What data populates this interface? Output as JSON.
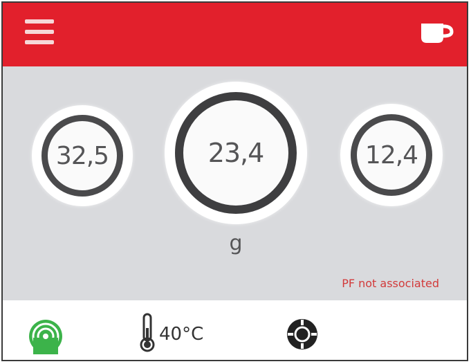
{
  "header": {
    "menu_icon": "hamburger-menu-icon",
    "cup_icon": "coffee-cup-icon",
    "accent_color": "#e2202c"
  },
  "readings": {
    "left": "32,5",
    "center": "23,4",
    "right": "12,4",
    "unit": "g"
  },
  "status": {
    "message": "PF not associated",
    "color": "#d23a3a"
  },
  "footer": {
    "signal_icon": "wireless-signal-icon",
    "signal_color": "#3cb34a",
    "thermometer_icon": "thermometer-icon",
    "temperature": "40°C",
    "dial_icon": "dial-icon"
  }
}
